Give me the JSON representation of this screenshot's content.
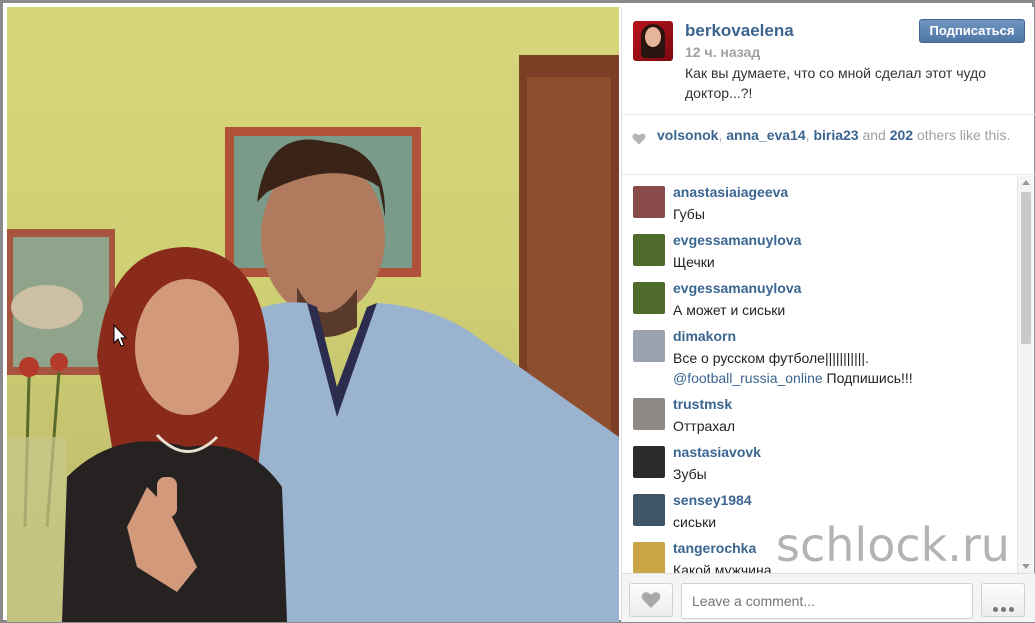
{
  "post": {
    "owner": "berkovaelena",
    "time_ago": "12 ч. назад",
    "caption": "Как вы думаете, что со мной сделал этот чудо доктор...?!",
    "follow_label": "Подписаться"
  },
  "likes": {
    "users": [
      "volsonok",
      "anna_eva14",
      "biria23"
    ],
    "sep1": ", ",
    "sep2": ", ",
    "and_text": " and ",
    "count": "202",
    "others_text": " others like this."
  },
  "comments": [
    {
      "user": "anastasiaiageeva",
      "text": "Губы",
      "avatar": "#8a4b4b"
    },
    {
      "user": "evgessamanuylova",
      "text": "Щечки",
      "avatar": "#4f6b2c"
    },
    {
      "user": "evgessamanuylova",
      "text": "А может и сиськи",
      "avatar": "#4f6b2c"
    },
    {
      "user": "dimakorn",
      "text_pre": "Все о русском футболе|||||||||||.",
      "tag": "@football_russia_online",
      "text_post": " Подпишись!!!",
      "avatar": "#9aa2b0"
    },
    {
      "user": "trustmsk",
      "text": "Оттрахал",
      "avatar": "#8f8a86"
    },
    {
      "user": "nastasiavovk",
      "text": "Зубы",
      "avatar": "#2b2b2b"
    },
    {
      "user": "sensey1984",
      "text": "сиськи",
      "avatar": "#3d5566"
    },
    {
      "user": "tangerochka",
      "text": "Какой мужчина",
      "avatar": "#c9a545"
    }
  ],
  "footer": {
    "comment_placeholder": "Leave a comment..."
  },
  "watermark": "schlock.ru",
  "icons": {
    "like": "heart-icon",
    "more": "more-dots-icon"
  }
}
